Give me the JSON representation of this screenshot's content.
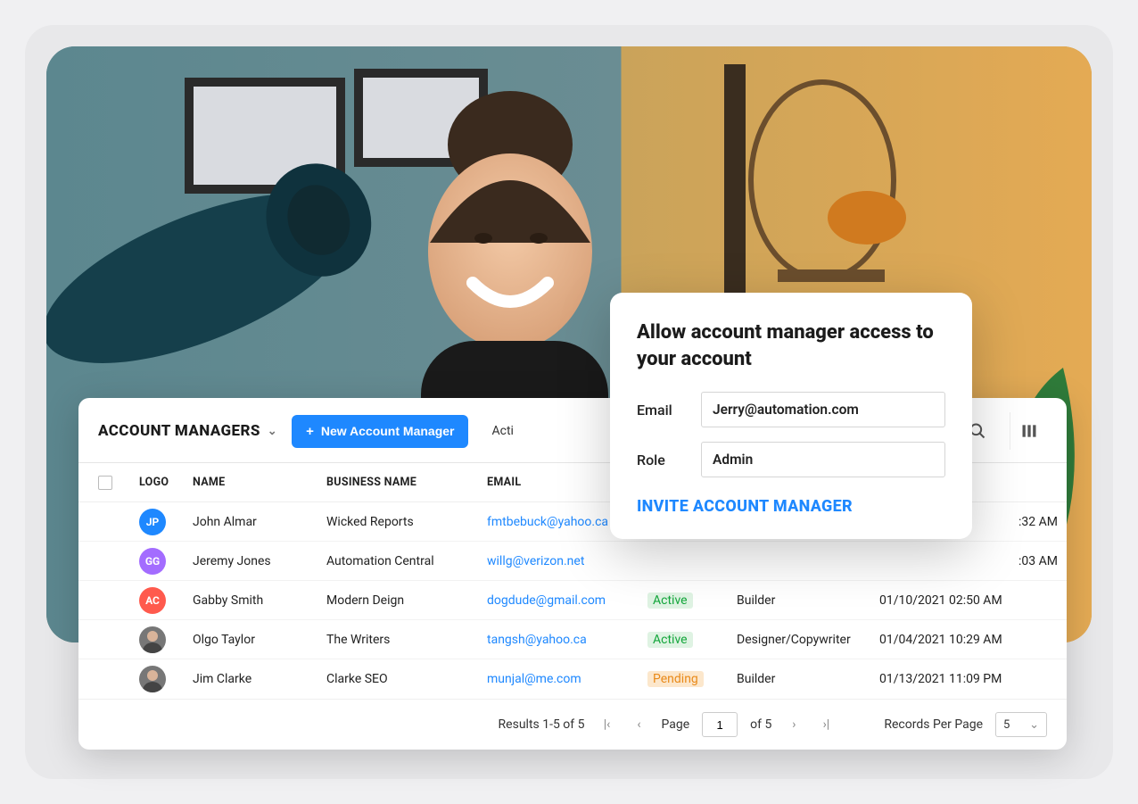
{
  "hero": {
    "alt": "Smiling woman holding a rolled yoga mat in a home setting"
  },
  "toolbar": {
    "title": "ACCOUNT MANAGERS",
    "new_button": "New Account Manager",
    "filter_partial": "Acti"
  },
  "columns": {
    "logo": "LOGO",
    "name": "NAME",
    "business": "BUSINESS NAME",
    "email": "EMAIL"
  },
  "rows": [
    {
      "initials": "JP",
      "logo_color": "#1e88ff",
      "name": "John Almar",
      "business": "Wicked Reports",
      "email": "fmtbebuck@yahoo.ca",
      "status": "",
      "role": "",
      "timestamp_suffix": ":32 AM"
    },
    {
      "initials": "GG",
      "logo_color": "#a36cff",
      "name": "Jeremy Jones",
      "business": "Automation Central",
      "email": "willg@verizon.net",
      "status": "",
      "role": "",
      "timestamp_suffix": ":03 AM"
    },
    {
      "initials": "AC",
      "logo_color": "#ff5a4d",
      "name": "Gabby Smith",
      "business": "Modern Deign",
      "email": "dogdude@gmail.com",
      "status": "Active",
      "role": "Builder",
      "timestamp": "01/10/2021 02:50 AM"
    },
    {
      "avatar": true,
      "name": "Olgo Taylor",
      "business": "The Writers",
      "email": "tangsh@yahoo.ca",
      "status": "Active",
      "role": "Designer/Copywriter",
      "timestamp": "01/04/2021 10:29 AM"
    },
    {
      "avatar": true,
      "name": "Jim Clarke",
      "business": "Clarke SEO",
      "email": "munjal@me.com",
      "status": "Pending",
      "role": "Builder",
      "timestamp": "01/13/2021 11:09 PM"
    }
  ],
  "pager": {
    "results": "Results 1-5 of 5",
    "page_label": "Page",
    "page_value": "1",
    "of_label": "of 5",
    "records_label": "Records Per Page",
    "records_value": "5"
  },
  "modal": {
    "title": "Allow account manager access to your account",
    "email_label": "Email",
    "email_value": "Jerry@automation.com",
    "role_label": "Role",
    "role_value": "Admin",
    "cta": "INVITE ACCOUNT MANAGER"
  }
}
